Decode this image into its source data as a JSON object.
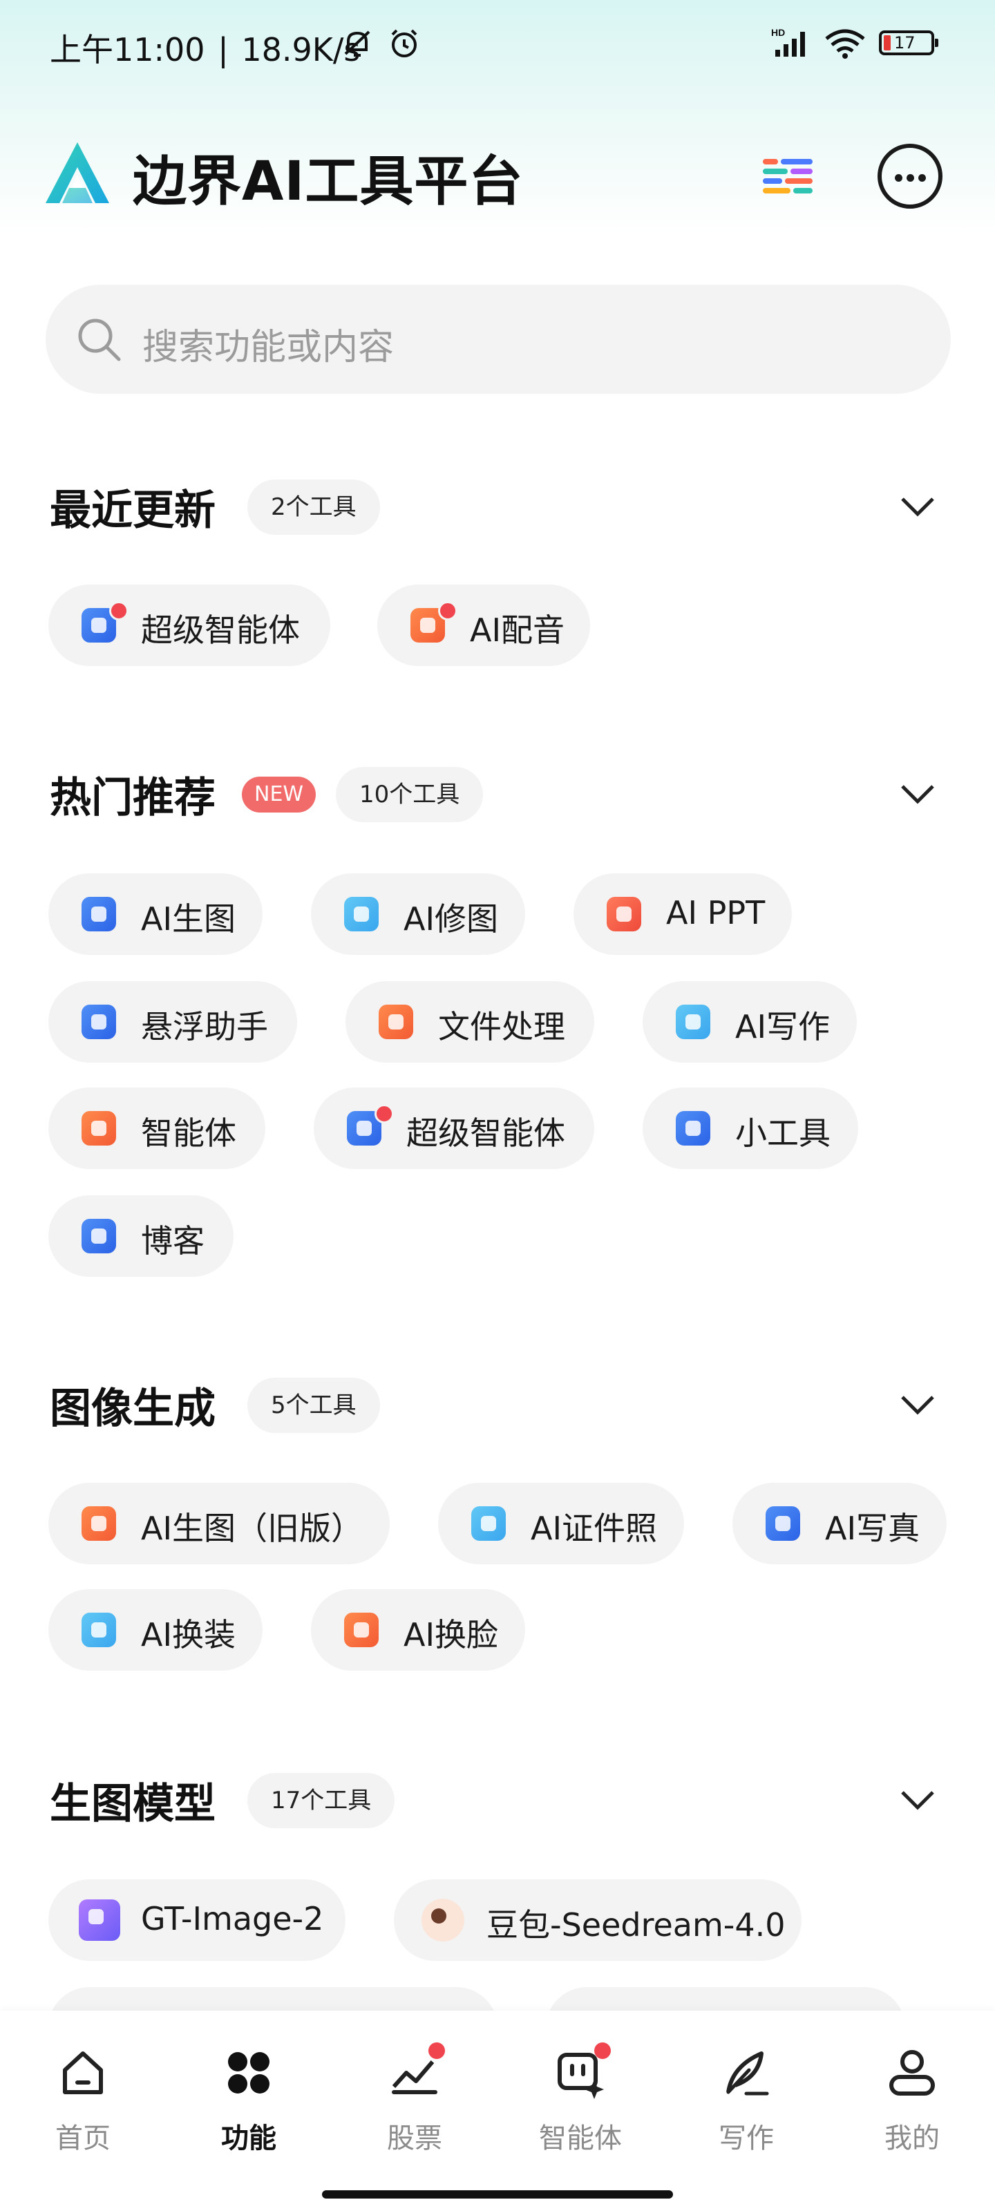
{
  "status_bar": {
    "time": "上午11:00",
    "speed": "18.9K/s",
    "battery": "17"
  },
  "header": {
    "title": "边界AI工具平台"
  },
  "search": {
    "placeholder": "搜索功能或内容"
  },
  "sections": [
    {
      "title": "最近更新",
      "count": "2个工具",
      "items": [
        {
          "label": "超级智能体",
          "icon": "robot-icon",
          "color": "#2c63e6",
          "dot": true
        },
        {
          "label": "AI配音",
          "icon": "lock-icon",
          "color": "#f35b34",
          "dot": true
        }
      ]
    },
    {
      "title": "热门推荐",
      "badge": "NEW",
      "count": "10个工具",
      "items": [
        {
          "label": "AI生图",
          "icon": "image-gen-icon",
          "color": "#2c63e6"
        },
        {
          "label": "AI修图",
          "icon": "image-edit-icon",
          "color": "#3aa6ee"
        },
        {
          "label": "AI PPT",
          "icon": "ppt-icon",
          "color": "#f35b34"
        },
        {
          "label": "悬浮助手",
          "icon": "floating-icon",
          "color": "#2c63e6"
        },
        {
          "label": "文件处理",
          "icon": "file-icon",
          "color": "#f35b34"
        },
        {
          "label": "AI写作",
          "icon": "writing-icon",
          "color": "#3aa6ee"
        },
        {
          "label": "智能体",
          "icon": "agent-icon",
          "color": "#f35b34"
        },
        {
          "label": "超级智能体",
          "icon": "robot-icon",
          "color": "#2c63e6",
          "dot": true
        },
        {
          "label": "小工具",
          "icon": "toolbox-icon",
          "color": "#2c63e6"
        },
        {
          "label": "博客",
          "icon": "blog-icon",
          "color": "#2c63e6"
        }
      ]
    },
    {
      "title": "图像生成",
      "count": "5个工具",
      "items": [
        {
          "label": "AI生图（旧版）",
          "icon": "palette-icon",
          "color": "#f35b34"
        },
        {
          "label": "AI证件照",
          "icon": "id-photo-icon",
          "color": "#3aa6ee"
        },
        {
          "label": "AI写真",
          "icon": "portrait-icon",
          "color": "#2c63e6"
        },
        {
          "label": "AI换装",
          "icon": "outfit-icon",
          "color": "#3aa6ee"
        },
        {
          "label": "AI换脸",
          "icon": "face-swap-icon",
          "color": "#f35b34"
        }
      ]
    },
    {
      "title": "生图模型",
      "count": "17个工具",
      "items": [
        {
          "label": "GT-Image-2",
          "icon": "model-logo-icon",
          "color": "#6b5cf6"
        },
        {
          "label": "豆包-Seedream-4.0",
          "icon": "doubao-avatar-icon",
          "color": "#fbe4d8"
        }
      ]
    }
  ],
  "bottom_nav": [
    {
      "label": "首页",
      "icon": "home-icon"
    },
    {
      "label": "功能",
      "icon": "grid-icon",
      "active": true
    },
    {
      "label": "股票",
      "icon": "stock-chart-icon",
      "dot": true
    },
    {
      "label": "智能体",
      "icon": "agent-sparkle-icon",
      "dot": true
    },
    {
      "label": "写作",
      "icon": "feather-pen-icon"
    },
    {
      "label": "我的",
      "icon": "profile-icon"
    }
  ]
}
